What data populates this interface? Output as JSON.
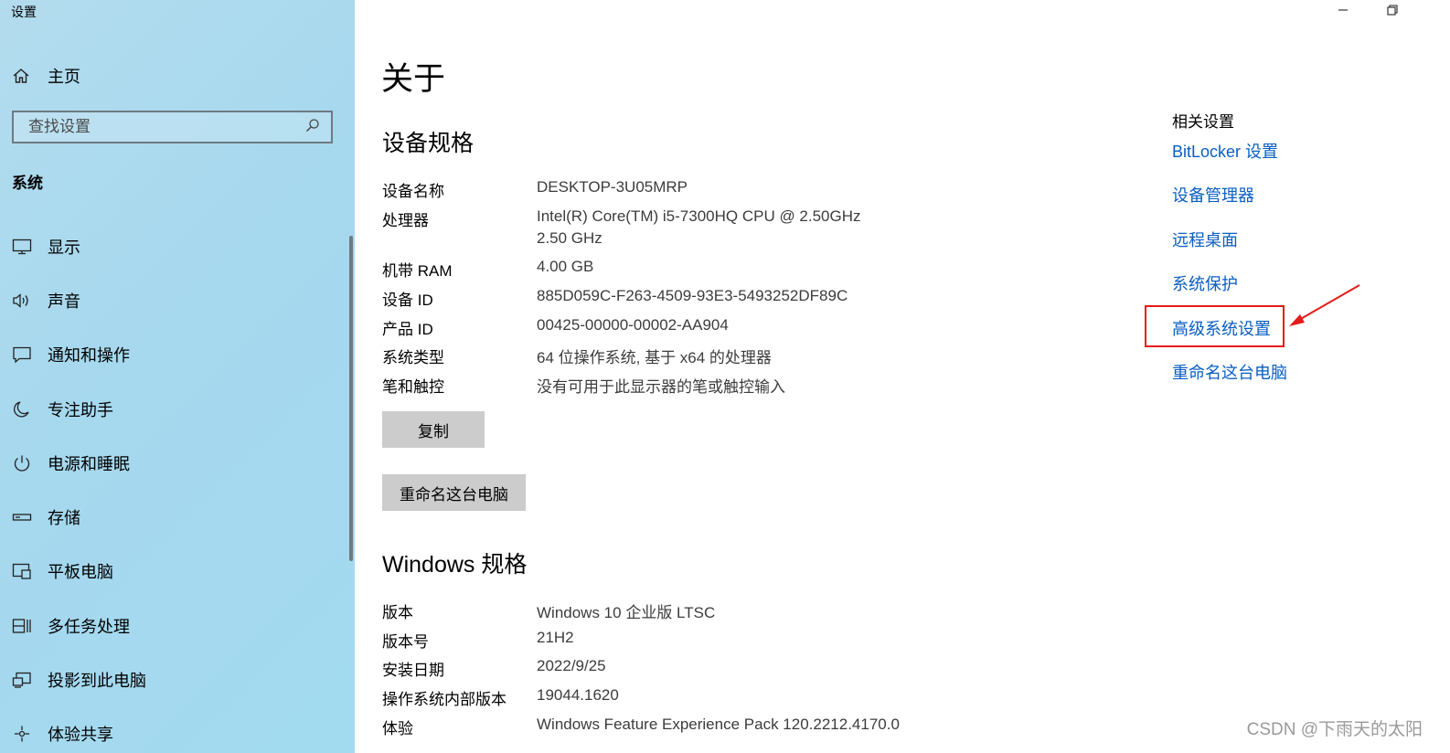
{
  "window": {
    "title": "设置",
    "minimize_glyph": "—",
    "restore_glyph": "❐"
  },
  "sidebar": {
    "home_label": "主页",
    "search_placeholder": "查找设置",
    "section_label": "系统",
    "items": [
      {
        "label": "显示",
        "icon": "monitor-icon"
      },
      {
        "label": "声音",
        "icon": "speaker-icon"
      },
      {
        "label": "通知和操作",
        "icon": "notification-icon"
      },
      {
        "label": "专注助手",
        "icon": "moon-icon"
      },
      {
        "label": "电源和睡眠",
        "icon": "power-icon"
      },
      {
        "label": "存储",
        "icon": "storage-icon"
      },
      {
        "label": "平板电脑",
        "icon": "tablet-icon"
      },
      {
        "label": "多任务处理",
        "icon": "multitask-icon"
      },
      {
        "label": "投影到此电脑",
        "icon": "project-icon"
      },
      {
        "label": "体验共享",
        "icon": "share-icon"
      }
    ]
  },
  "main": {
    "title": "关于",
    "device_specs": {
      "heading": "设备规格",
      "rows": [
        {
          "key": "设备名称",
          "value": "DESKTOP-3U05MRP"
        },
        {
          "key": "处理器",
          "value": "Intel(R) Core(TM) i5-7300HQ CPU @ 2.50GHz",
          "value2": "2.50 GHz"
        },
        {
          "key": "机带 RAM",
          "value": "4.00 GB"
        },
        {
          "key": "设备 ID",
          "value": "885D059C-F263-4509-93E3-5493252DF89C"
        },
        {
          "key": "产品 ID",
          "value": "00425-00000-00002-AA904"
        },
        {
          "key": "系统类型",
          "value": "64 位操作系统, 基于 x64 的处理器"
        },
        {
          "key": "笔和触控",
          "value": "没有可用于此显示器的笔或触控输入"
        }
      ],
      "copy_button": "复制",
      "rename_button": "重命名这台电脑"
    },
    "windows_specs": {
      "heading": "Windows 规格",
      "rows": [
        {
          "key": "版本",
          "value": "Windows 10 企业版 LTSC"
        },
        {
          "key": "版本号",
          "value": "21H2"
        },
        {
          "key": "安装日期",
          "value": "2022/9/25"
        },
        {
          "key": "操作系统内部版本",
          "value": "19044.1620"
        },
        {
          "key": "体验",
          "value": "Windows Feature Experience Pack 120.2212.4170.0"
        }
      ]
    }
  },
  "related": {
    "heading": "相关设置",
    "links": [
      "BitLocker 设置",
      "设备管理器",
      "远程桌面",
      "系统保护",
      "高级系统设置",
      "重命名这台电脑"
    ],
    "highlight_color": "#e51b1b",
    "link_color": "#0a5ec2"
  },
  "watermark": "CSDN @下雨天的太阳"
}
